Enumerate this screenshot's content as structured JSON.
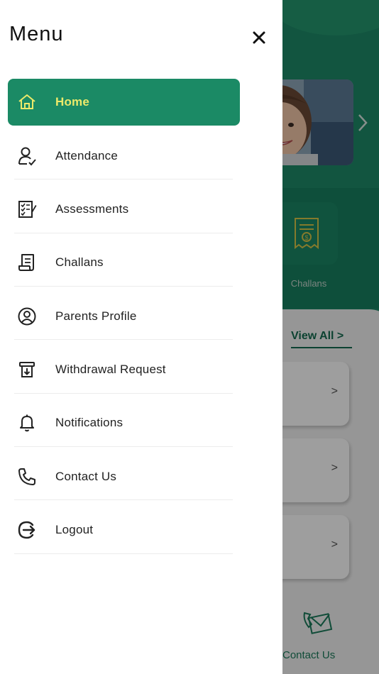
{
  "drawer": {
    "title": "Menu",
    "close_icon": "close-icon",
    "items": [
      {
        "label": "Home",
        "icon": "home-icon",
        "active": true
      },
      {
        "label": "Attendance",
        "icon": "user-check-icon",
        "active": false
      },
      {
        "label": "Assessments",
        "icon": "checklist-icon",
        "active": false
      },
      {
        "label": "Challans",
        "icon": "receipt-icon",
        "active": false
      },
      {
        "label": "Parents Profile",
        "icon": "profile-icon",
        "active": false
      },
      {
        "label": "Withdrawal Request",
        "icon": "withdraw-icon",
        "active": false
      },
      {
        "label": "Notifications",
        "icon": "bell-icon",
        "active": false
      },
      {
        "label": "Contact Us",
        "icon": "phone-icon",
        "active": false
      },
      {
        "label": "Logout",
        "icon": "logout-icon",
        "active": false
      }
    ]
  },
  "background": {
    "quick_tile_label": "Challans",
    "view_all_label": "View All  >",
    "card_arrow": ">",
    "contact_label": "Contact Us"
  },
  "colors": {
    "accent": "#1b8a65",
    "active_label": "#ece96a",
    "scrim": "rgba(0,0,0,0.38)"
  }
}
